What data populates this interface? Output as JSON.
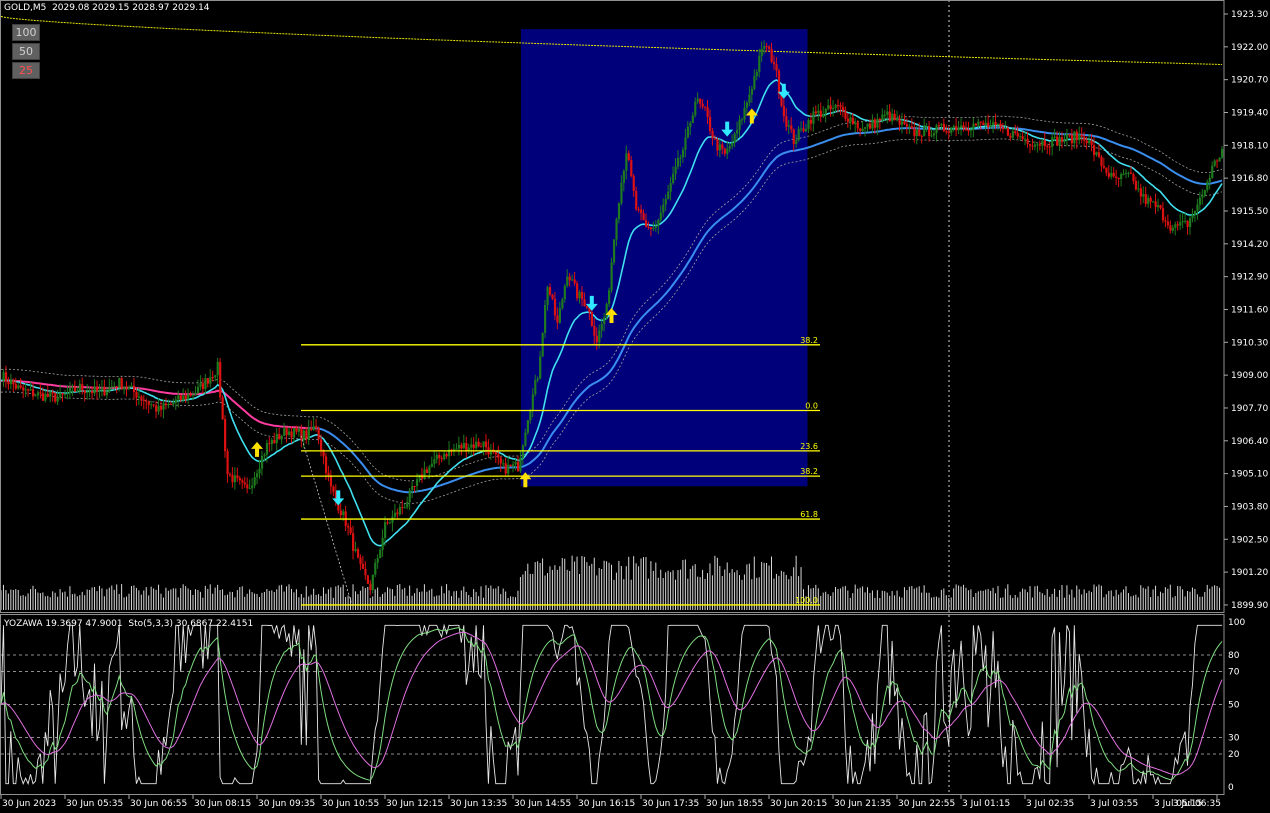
{
  "window": {
    "symbol_line": "GOLD,M5  2029.08 2029.15 2028.97 2029.14",
    "osc_line": "YOZAWA 19.3697 47.9001  Sto(5,3,3) 30.6867 22.4151"
  },
  "buttons": [
    {
      "label": "100",
      "color": "#d0d0d0"
    },
    {
      "label": "50",
      "color": "#d0d0d0"
    },
    {
      "label": "25",
      "color": "#ff4040"
    }
  ],
  "colors": {
    "background": "#000000",
    "bull": "#1e7a1e",
    "bear": "#dd1111",
    "highlight_box": "#00007a",
    "fib": "#ffff00",
    "ma_fast": "#40e0f0",
    "ma_slow": "#3a8ef0",
    "ma_magenta": "#ff3ca0",
    "stoch_main": "#7fdc7f",
    "stoch_signal": "#e070e0",
    "yozawa": "#e8e8e8"
  },
  "chart_data": [
    {
      "type": "candlestick",
      "symbol": "GOLD",
      "timeframe": "M5",
      "ylim": [
        1899.7,
        1923.3
      ],
      "y_ticks": [
        "1923.30",
        "1922.00",
        "1920.70",
        "1919.40",
        "1918.10",
        "1916.80",
        "1915.50",
        "1914.20",
        "1912.90",
        "1911.60",
        "1910.30",
        "1909.00",
        "1907.70",
        "1906.40",
        "1905.10",
        "1903.80",
        "1902.50",
        "1901.20",
        "1899.90"
      ],
      "x_ticks": [
        "30 Jun 2023",
        "30 Jun 05:35",
        "30 Jun 06:55",
        "30 Jun 08:15",
        "30 Jun 09:35",
        "30 Jun 10:55",
        "30 Jun 12:15",
        "30 Jun 13:35",
        "30 Jun 14:55",
        "30 Jun 16:15",
        "30 Jun 17:35",
        "30 Jun 18:55",
        "30 Jun 20:15",
        "30 Jun 21:35",
        "30 Jun 22:55",
        "3 Jul 01:15",
        "3 Jul 02:35",
        "3 Jul 03:55",
        "3 Jul 05:15",
        "3 Jul 06:35"
      ],
      "fibonacci": [
        {
          "level": "38.2",
          "price": 1910.2
        },
        {
          "level": "0.0",
          "price": 1907.6
        },
        {
          "level": "23.6",
          "price": 1906.0
        },
        {
          "level": "38.2",
          "price": 1905.0
        },
        {
          "level": "61.8",
          "price": 1903.3
        },
        {
          "level": "100.0",
          "price": 1899.9
        }
      ],
      "close_path": [
        [
          0,
          1909.0
        ],
        [
          8,
          1908.4
        ],
        [
          16,
          1908.2
        ],
        [
          24,
          1908.1
        ],
        [
          32,
          1908.5
        ],
        [
          40,
          1908.3
        ],
        [
          48,
          1908.7
        ],
        [
          56,
          1908.2
        ],
        [
          64,
          1907.6
        ],
        [
          72,
          1908.0
        ],
        [
          80,
          1908.4
        ],
        [
          88,
          1909.3
        ],
        [
          92,
          1905.1
        ],
        [
          100,
          1904.4
        ],
        [
          108,
          1906.2
        ],
        [
          116,
          1906.8
        ],
        [
          124,
          1906.6
        ],
        [
          128,
          1907.0
        ],
        [
          134,
          1904.5
        ],
        [
          140,
          1903.2
        ],
        [
          146,
          1901.3
        ],
        [
          150,
          1900.6
        ],
        [
          156,
          1903.0
        ],
        [
          164,
          1903.9
        ],
        [
          172,
          1905.2
        ],
        [
          180,
          1905.9
        ],
        [
          188,
          1906.2
        ],
        [
          196,
          1906.3
        ],
        [
          204,
          1905.3
        ],
        [
          210,
          1905.4
        ],
        [
          214,
          1907.4
        ],
        [
          218,
          1909.0
        ],
        [
          222,
          1912.6
        ],
        [
          226,
          1911.0
        ],
        [
          230,
          1913.1
        ],
        [
          234,
          1912.2
        ],
        [
          238,
          1911.8
        ],
        [
          242,
          1910.4
        ],
        [
          246,
          1911.6
        ],
        [
          250,
          1915.4
        ],
        [
          254,
          1917.9
        ],
        [
          258,
          1915.6
        ],
        [
          262,
          1914.8
        ],
        [
          266,
          1914.9
        ],
        [
          270,
          1915.9
        ],
        [
          274,
          1917.1
        ],
        [
          278,
          1918.2
        ],
        [
          282,
          1919.9
        ],
        [
          286,
          1919.4
        ],
        [
          290,
          1918.2
        ],
        [
          294,
          1917.7
        ],
        [
          298,
          1918.4
        ],
        [
          302,
          1919.5
        ],
        [
          306,
          1920.8
        ],
        [
          310,
          1922.1
        ],
        [
          314,
          1921.4
        ],
        [
          318,
          1919.3
        ],
        [
          322,
          1918.3
        ],
        [
          330,
          1919.3
        ],
        [
          340,
          1919.6
        ],
        [
          350,
          1918.7
        ],
        [
          360,
          1919.3
        ],
        [
          370,
          1918.6
        ],
        [
          380,
          1918.7
        ],
        [
          390,
          1918.9
        ],
        [
          400,
          1918.9
        ],
        [
          410,
          1918.6
        ],
        [
          420,
          1918.2
        ],
        [
          430,
          1918.3
        ],
        [
          440,
          1918.5
        ],
        [
          446,
          1917.5
        ],
        [
          452,
          1916.7
        ],
        [
          458,
          1916.9
        ],
        [
          464,
          1916.0
        ],
        [
          470,
          1915.6
        ],
        [
          476,
          1914.8
        ],
        [
          482,
          1915.0
        ],
        [
          488,
          1916.1
        ],
        [
          492,
          1917.2
        ],
        [
          496,
          1917.9
        ]
      ],
      "bars_total": 496,
      "highlight_range_bars": [
        210,
        326
      ],
      "signals": [
        {
          "type": "up",
          "bar": 104,
          "price": 1906.0
        },
        {
          "type": "down",
          "bar": 137,
          "price": 1904.2
        },
        {
          "type": "up",
          "bar": 213,
          "price": 1904.8
        },
        {
          "type": "down",
          "bar": 240,
          "price": 1911.9
        },
        {
          "type": "up",
          "bar": 248,
          "price": 1911.3
        },
        {
          "type": "down",
          "bar": 295,
          "price": 1918.8
        },
        {
          "type": "up",
          "bar": 305,
          "price": 1919.2
        },
        {
          "type": "down",
          "bar": 318,
          "price": 1920.3
        }
      ]
    },
    {
      "type": "line",
      "name": "oscillator",
      "ylim": [
        0,
        100
      ],
      "y_ticks": [
        "100",
        "80",
        "70",
        "50",
        "30",
        "20",
        "0"
      ]
    }
  ]
}
